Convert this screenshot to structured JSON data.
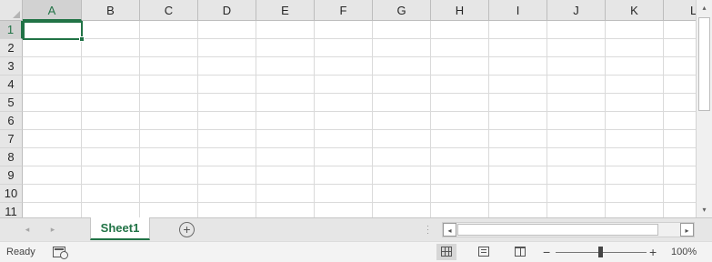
{
  "columns": [
    "A",
    "B",
    "C",
    "D",
    "E",
    "F",
    "G",
    "H",
    "I",
    "J",
    "K",
    "L"
  ],
  "rows": [
    "1",
    "2",
    "3",
    "4",
    "5",
    "6",
    "7",
    "8",
    "9",
    "10",
    "11"
  ],
  "active_cell": "A1",
  "sheet_tabs": [
    "Sheet1"
  ],
  "active_sheet": "Sheet1",
  "status": {
    "ready_text": "Ready",
    "zoom_level": "100%",
    "zoom_minus": "−",
    "zoom_plus": "+"
  },
  "icons": {
    "add_sheet": "+",
    "tab_prev": "◂",
    "tab_next": "▸",
    "scroll_up": "▴",
    "scroll_down": "▾",
    "scroll_left": "◂",
    "scroll_right": "▸"
  },
  "colors": {
    "accent": "#217346",
    "header_bg": "#e6e6e6",
    "gridline": "#dadada"
  }
}
